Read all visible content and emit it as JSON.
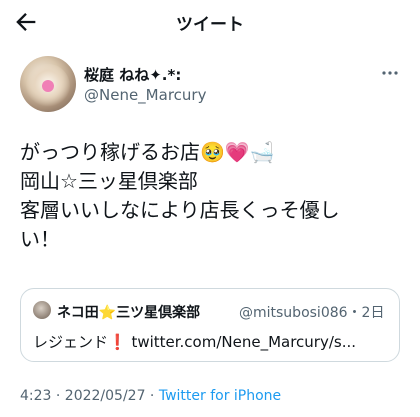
{
  "header": {
    "title": "ツイート",
    "back_icon": "arrow-left-icon"
  },
  "author": {
    "display_name": "桜庭 ねね✦.*:",
    "handle": "@Nene_Marcury"
  },
  "tweet": {
    "lines": [
      "がっつり稼げるお店🥹💗🛁",
      "岡山☆三ッ星倶楽部",
      "客層いいしなにより店長くっそ優し",
      "い！"
    ]
  },
  "quoted": {
    "name": "ネコ田⭐三ツ星倶楽部",
    "handle_time": "@mitsubosi086・2日",
    "text": "レジェンド❗ twitter.com/Nene_Marcury/s..."
  },
  "meta": {
    "time_date": "4:23 · 2022/05/27 · ",
    "source": "Twitter for iPhone"
  },
  "colors": {
    "link": "#1d9bf0",
    "secondary": "#536471",
    "border": "#cfd9de"
  }
}
